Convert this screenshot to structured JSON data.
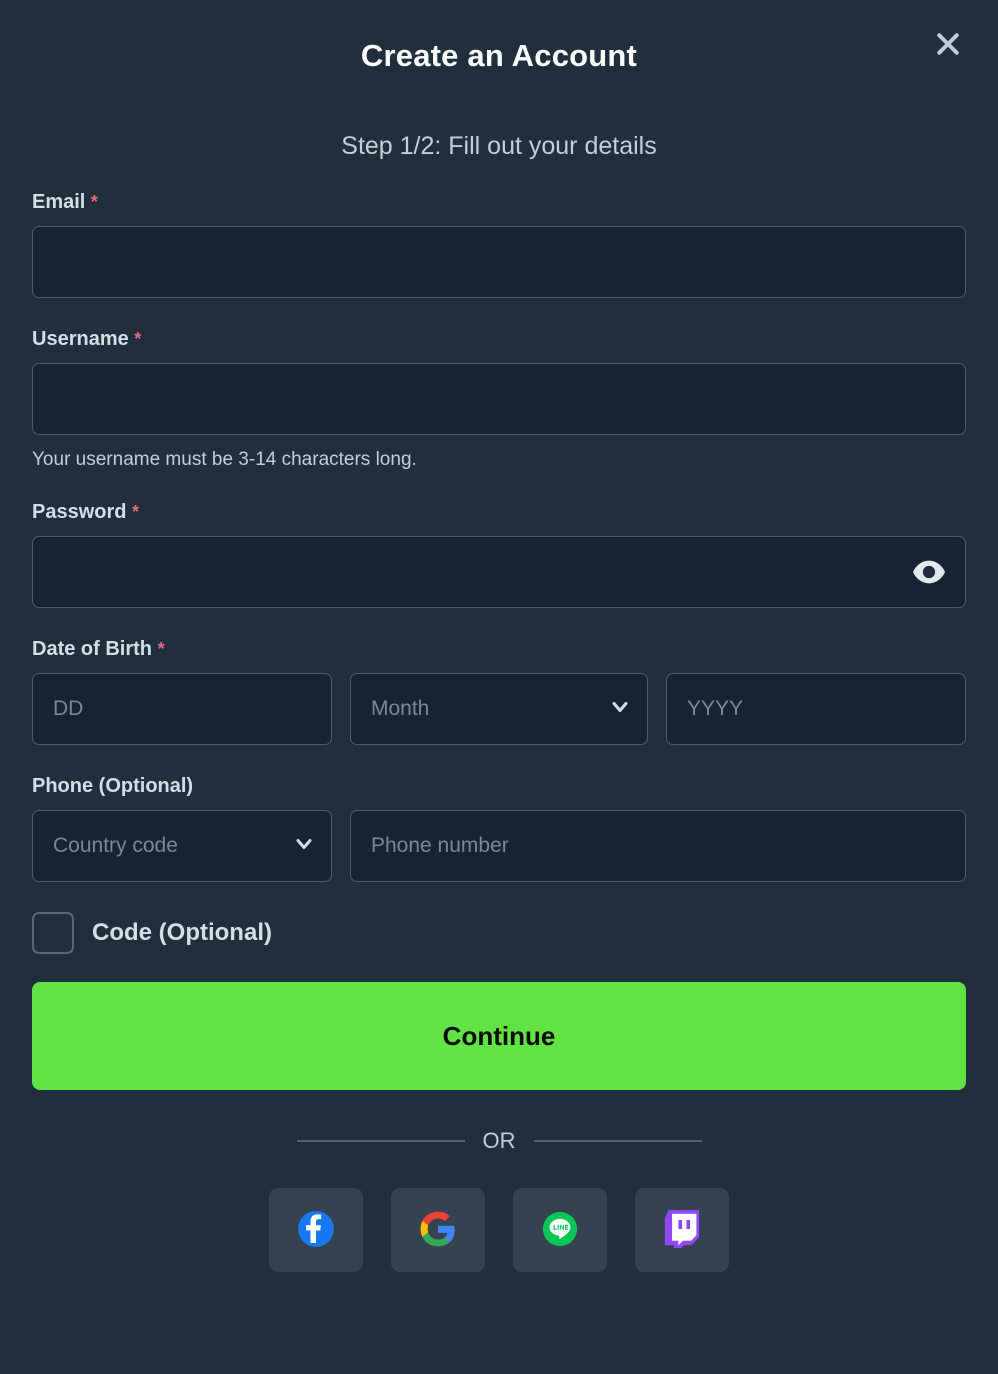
{
  "modal": {
    "title": "Create an Account",
    "subtitle": "Step 1/2: Fill out your details",
    "close_icon": "close-icon"
  },
  "form": {
    "email": {
      "label": "Email",
      "required_mark": "*",
      "value": "",
      "placeholder": ""
    },
    "username": {
      "label": "Username",
      "required_mark": "*",
      "value": "",
      "placeholder": "",
      "hint": "Your username must be 3-14 characters long."
    },
    "password": {
      "label": "Password",
      "required_mark": "*",
      "value": "",
      "placeholder": "",
      "toggle_icon": "eye-icon"
    },
    "date_of_birth": {
      "label": "Date of Birth",
      "required_mark": "*",
      "day_placeholder": "DD",
      "day_value": "",
      "month_selected": "Month",
      "year_placeholder": "YYYY",
      "year_value": "",
      "chevron_icon": "chevron-down-icon"
    },
    "phone": {
      "label": "Phone (Optional)",
      "country_code_selected": "Country code",
      "number_placeholder": "Phone number",
      "number_value": "",
      "chevron_icon": "chevron-down-icon"
    },
    "code": {
      "label": "Code (Optional)",
      "checked": false
    }
  },
  "actions": {
    "continue_label": "Continue",
    "divider_label": "OR"
  },
  "social": [
    {
      "name": "facebook",
      "label": "Facebook"
    },
    {
      "name": "google",
      "label": "Google"
    },
    {
      "name": "line",
      "label": "LINE"
    },
    {
      "name": "twitch",
      "label": "Twitch"
    }
  ],
  "colors": {
    "background": "#212f3d",
    "input_fill": "#172334",
    "input_border": "#4d5b6a",
    "accent_green": "#62e344",
    "required_red": "#e8697d",
    "social_tile": "#36424f"
  }
}
